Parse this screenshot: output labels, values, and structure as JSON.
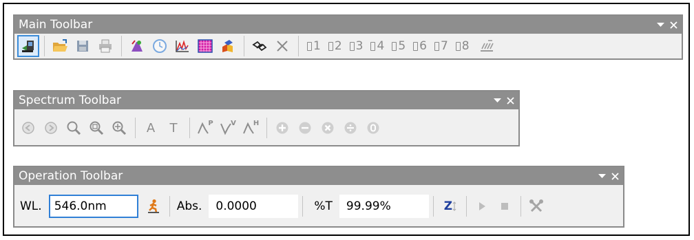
{
  "main_toolbar": {
    "title": "Main Toolbar",
    "buttons": [
      "connect-icon",
      "open-folder-icon",
      "save-icon",
      "print-icon",
      "method-icon",
      "clock-icon",
      "spectrum-chart-icon",
      "grid-icon",
      "cells-icon",
      "link-icon",
      "cancel-icon"
    ],
    "slots": [
      "1",
      "2",
      "3",
      "4",
      "5",
      "6",
      "7",
      "8"
    ],
    "colors": {
      "active_border": "#3b8cd9",
      "title_bg": "#8e8e8e"
    }
  },
  "spectrum_toolbar": {
    "title": "Spectrum Toolbar",
    "a_label": "A",
    "t_label": "T",
    "peak_label": "P",
    "valley_label": "V",
    "h_label": "H"
  },
  "operation_toolbar": {
    "title": "Operation Toolbar",
    "wl_label": "WL.",
    "wl_value": "546.0nm",
    "abs_label": "Abs.",
    "abs_value": "0.0000",
    "t_label": "%T",
    "t_value": "99.99%",
    "zero_label": "Z"
  }
}
